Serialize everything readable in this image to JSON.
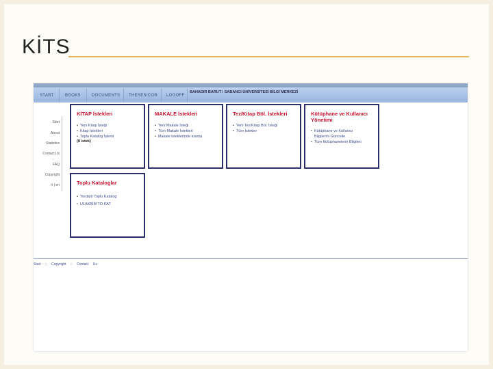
{
  "slide": {
    "title": "KİTS"
  },
  "app": {
    "site_title": "BAHADIR BARUT / SABANCI ÜNİVERSİTESİ BİLGİ MERKEZİ"
  },
  "nav": {
    "items": [
      "START",
      "BOOKS",
      "DOCUMENTS",
      "THESES/COR",
      "LOGOFF"
    ]
  },
  "left_menu": {
    "items": [
      "Start",
      "About",
      "Statistics",
      "Contact Us",
      "FAQ",
      "Copyright",
      "tr | en"
    ]
  },
  "boxes": [
    {
      "title": "KİTAP İstekleri",
      "items": [
        "Yeni Kitap İsteği",
        "Kitap İstekleri",
        "Toplu Katalog İşlemi"
      ],
      "extra": "(8 istek)"
    },
    {
      "title": "MAKALE İstekleri",
      "items": [
        "Yeni Makale İsteği",
        "Tüm Makale İstekleri",
        "Makale isteklerinde arama"
      ]
    },
    {
      "title": "Tez/Kitap Böl. İstekleri",
      "items": [
        "Yeni Tez/Kitap Böl. İsteği",
        "Tüm İstekler"
      ]
    },
    {
      "title_line1": "Kütüphane ve Kullanıcı",
      "title_line2": "Yönetimi",
      "items": [
        "Kütüphane ve Kullanıcı",
        "Bilgilerini Güncelle",
        "Tüm Kütüphanelerin Bilgileri"
      ]
    },
    {
      "title": "Toplu Kataloglar",
      "items": [
        "Yordam Toplu Katalog",
        "ULAKBİM TO KAT"
      ]
    }
  ],
  "footer": {
    "items": [
      "Start",
      "::",
      "Copyright",
      "::",
      "Contact",
      "Us"
    ]
  },
  "colors": {
    "accent_red": "#c8102e",
    "box_border": "#2b2f6b",
    "link_blue": "#3b4a8a",
    "title_rule": "#e3b75a"
  }
}
